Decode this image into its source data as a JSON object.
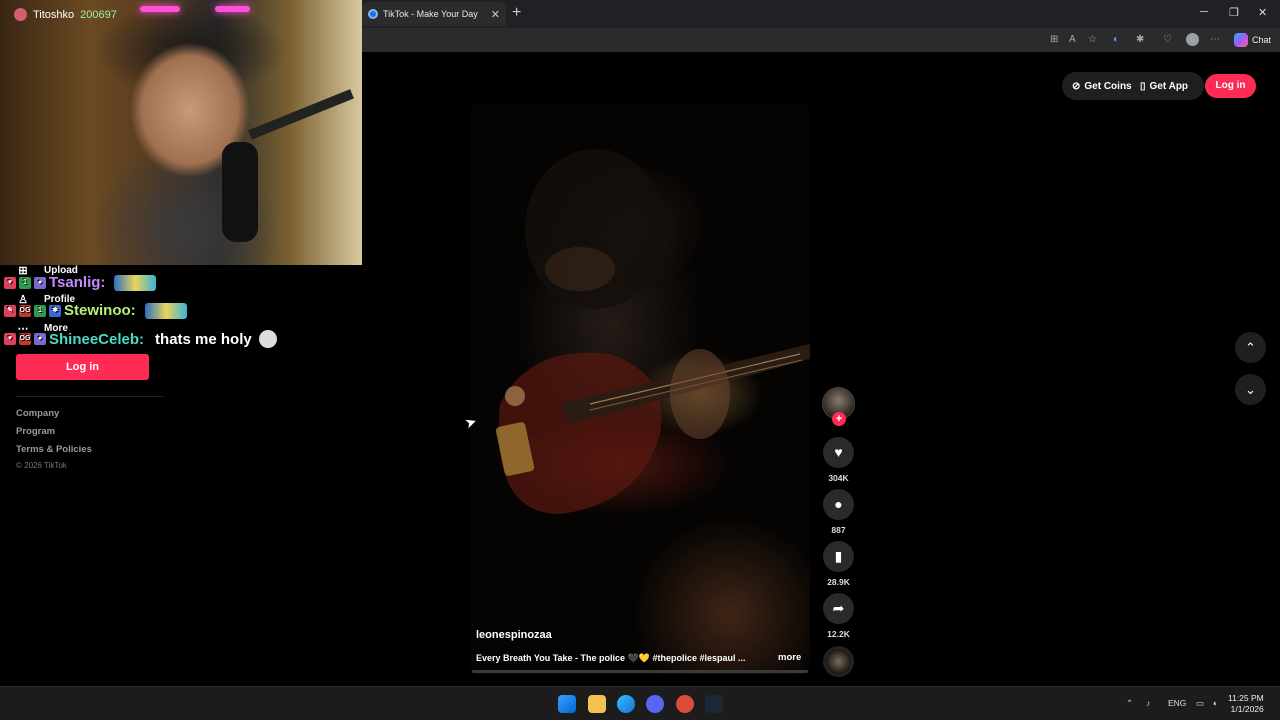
{
  "browser": {
    "tab_title": "TikTok - Make Your Day",
    "tab_close": "✕",
    "new_tab": "+",
    "copilot_label": "Chat"
  },
  "header": {
    "get_coins": "Get Coins",
    "get_app": "Get App",
    "login": "Log in"
  },
  "sidebar": {
    "items": [
      {
        "icon": "upload-icon",
        "label": "Upload"
      },
      {
        "icon": "profile-icon",
        "label": "Profile"
      },
      {
        "icon": "more-icon",
        "label": "More"
      }
    ],
    "login": "Log in",
    "links": [
      "Company",
      "Program",
      "Terms & Policies"
    ],
    "copyright": "© 2026 TikTok"
  },
  "video": {
    "author": "leonespinozaa",
    "description": "Every Breath You Take - The police 🖤💛 #thepolice #lespaul ...",
    "more": "more",
    "likes": "304K",
    "comments": "887",
    "saves": "28.9K",
    "shares": "12.2K"
  },
  "stream": {
    "streamer": "Titoshko",
    "points": "200697",
    "chat": [
      {
        "user": "Tsanlig:",
        "color": "#c48aff",
        "message": ""
      },
      {
        "user": "Stewinoo:",
        "color": "#b8f07a",
        "message": ""
      },
      {
        "user": "ShineeCeleb:",
        "color": "#4dd8c8",
        "message": "thats me holy"
      }
    ]
  },
  "taskbar": {
    "lang": "ENG",
    "time": "11:25 PM",
    "date": "1/1/2026"
  },
  "colors": {
    "accent": "#fe2c55",
    "background": "#000000"
  }
}
